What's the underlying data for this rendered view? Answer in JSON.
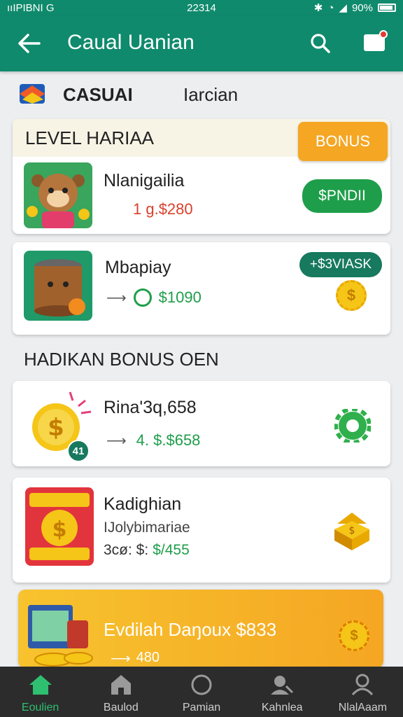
{
  "status_bar": {
    "left": "ııIPIBNI G",
    "time": "22314",
    "battery": "90%"
  },
  "app_bar": {
    "title": "Caual Uanian"
  },
  "category": {
    "name": "CASUAI",
    "subtitle": "Iarcian"
  },
  "section1": {
    "header": "LEVEL HARIAA",
    "badge": "BONUS",
    "items": [
      {
        "name": "Nlanigailia",
        "price": "1 g.$280",
        "button": "$PNDII"
      },
      {
        "name": "Mbapiay",
        "price": "$1090",
        "button": "+$3VIASK"
      }
    ]
  },
  "section2": {
    "header": "HADIKAN BONUS OEN",
    "items": [
      {
        "name": "Rina'3q,658",
        "price": "4. $.$658",
        "badge": "41"
      },
      {
        "name": "Kadighian",
        "subtitle": "IJolybimariae",
        "price_prefix": "3cø: $:",
        "price": "$/455"
      }
    ]
  },
  "promo": {
    "title": "Evdilah Daŋoux $833",
    "price": "480"
  },
  "tabs": [
    {
      "label": "Eoulien",
      "icon": "home-icon",
      "active": true
    },
    {
      "label": "Baulod",
      "icon": "house-icon",
      "active": false
    },
    {
      "label": "Pamian",
      "icon": "circle-icon",
      "active": false
    },
    {
      "label": "Kahnlea",
      "icon": "person-search-icon",
      "active": false
    },
    {
      "label": "NlalAaam",
      "icon": "profile-icon",
      "active": false
    }
  ],
  "colors": {
    "primary": "#0f8a6c",
    "accent": "#f5a623",
    "price_red": "#d9402b",
    "price_green": "#1e9e4a"
  }
}
